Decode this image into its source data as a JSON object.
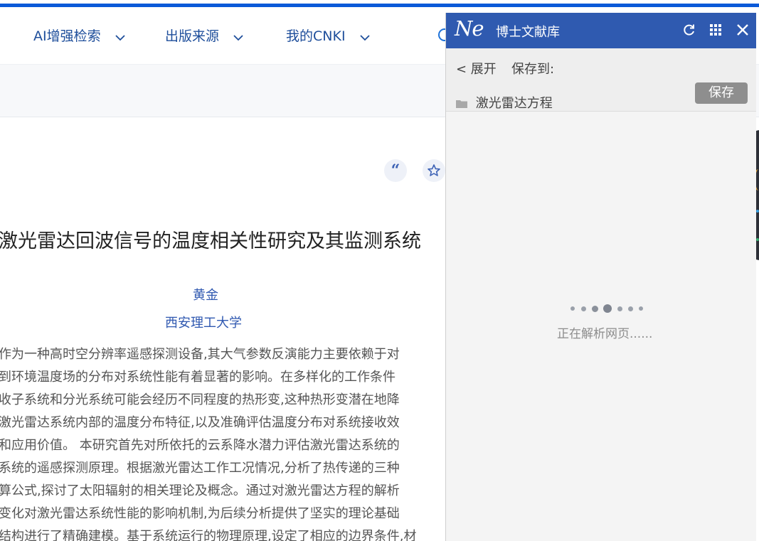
{
  "header": {
    "nav": [
      {
        "label": "AI增强检索"
      },
      {
        "label": "出版来源"
      },
      {
        "label": "我的CNKI"
      }
    ]
  },
  "article": {
    "title": "激光雷达回波信号的温度相关性研究及其监测系统",
    "author": "黄金",
    "affiliation": "西安理工大学",
    "abstract_lines": [
      "作为一种高时空分辨率遥感探测设备,其大气参数反演能力主要依赖于对",
      "到环境温度场的分布对系统性能有着显著的影响。在多样化的工作条件",
      "收子系统和分光系统可能会经历不同程度的热形变,这种热形变潜在地降",
      "激光雷达系统内部的温度分布特征,以及准确评估温度分布对系统接收效",
      "和应用价值。 本研究首先对所依托的云系降水潜力评估激光雷达系统的",
      "系统的遥感探测原理。根据激光雷达工作工况情况,分析了热传递的三种",
      "算公式,探讨了太阳辐射的相关理论及概念。通过对激光雷达方程的解析",
      "变化对激光雷达系统性能的影响机制,为后续分析提供了坚实的理论基础",
      "结构进行了精确建模。基于系统运行的物理原理,设定了相应的边界条件,材"
    ]
  },
  "plugin": {
    "logo": "Ne",
    "title": "博士文献库",
    "expand_label": "< 展开",
    "save_to_label": "保存到:",
    "save_button": "保存",
    "folder_name": "激光雷达方程",
    "loading_text": "正在解析网页......"
  },
  "colors": {
    "accent": "#0b5ad8",
    "plugin_header": "#2f5ab0",
    "nav_text": "#1e4e9b"
  }
}
